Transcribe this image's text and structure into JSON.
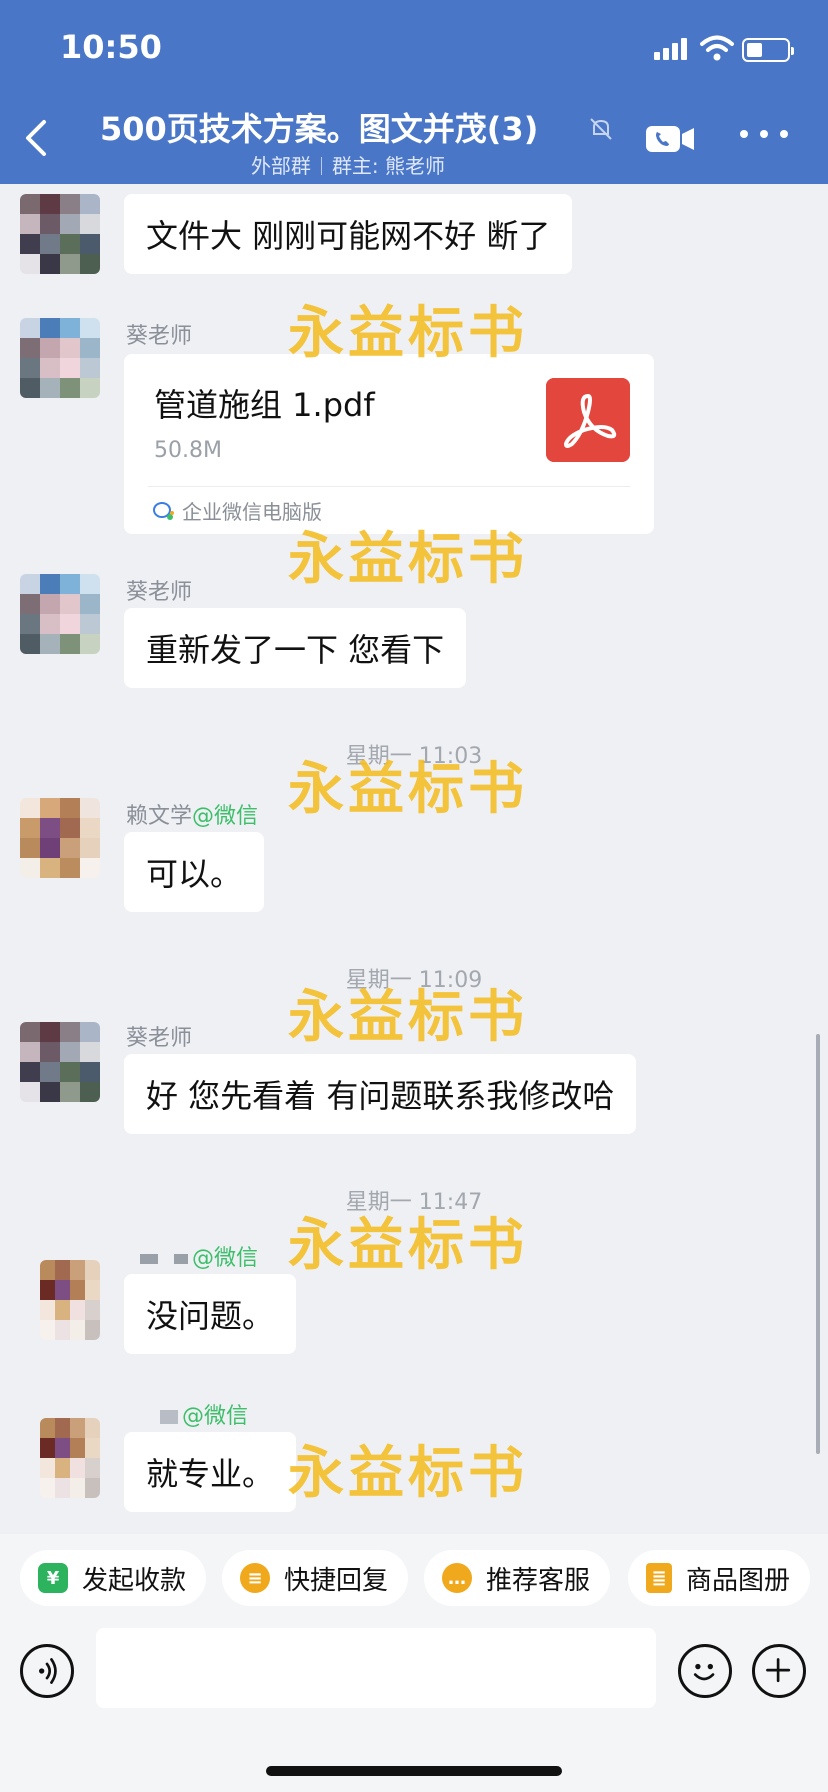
{
  "status_bar": {
    "time": "10:50"
  },
  "header": {
    "title": "500页技术方案。图文并茂(3)",
    "subtitle_tag": "外部群",
    "subtitle_owner": "群主: 熊老师",
    "icons": [
      "back-chevron-icon",
      "mute-bell-icon",
      "video-call-icon",
      "more-icon"
    ]
  },
  "chat": {
    "msg1_text": "文件大  刚刚可能网不好  断了",
    "msg2_sender": "葵老师",
    "file": {
      "name": "管道施组 1.pdf",
      "size": "50.8M",
      "source": "企业微信电脑版",
      "icon": "pdf-icon"
    },
    "msg3_sender": "葵老师",
    "msg3_text": "重新发了一下  您看下",
    "time1": "星期一 11:03",
    "msg4_sender": "赖文学",
    "msg4_source": "@微信",
    "msg4_text": "可以。",
    "time2": "星期一 11:09",
    "msg5_sender": "葵老师",
    "msg5_text": "好 您先看着 有问题联系我修改哈",
    "time3": "星期一 11:47",
    "msg6_source": "@微信",
    "msg6_text": "没问题。",
    "msg7_source": "@微信",
    "msg7_text": "就专业。",
    "watermark": "永益标书"
  },
  "quick_actions": [
    {
      "label": "发起收款",
      "icon": "payment-icon",
      "color": "#2db35e"
    },
    {
      "label": "快捷回复",
      "icon": "quick-reply-icon",
      "color": "#f0a81c"
    },
    {
      "label": "推荐客服",
      "icon": "service-icon",
      "color": "#f0a81c"
    },
    {
      "label": "商品图册",
      "icon": "catalog-icon",
      "color": "#f0a81c"
    }
  ],
  "input": {
    "placeholder": ""
  },
  "colors": {
    "header_bg": "#4a76c7",
    "chat_bg": "#eef0f4",
    "wechat_green": "#3dbf6a",
    "watermark": "#f4be28",
    "pdf_red": "#e2463d"
  }
}
